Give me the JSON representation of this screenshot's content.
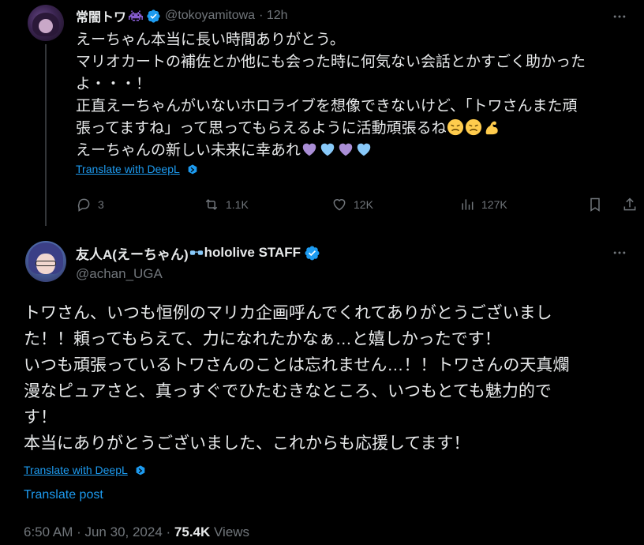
{
  "tweet1": {
    "display_name": "常闇トワ",
    "handle": "@tokoyamitowa",
    "time": "· 12h",
    "lines": [
      "えーちゃん本当に長い時間ありがとう。",
      "マリオカートの補佐とか他にも会った時に何気ない会話とかすごく助かった",
      "よ・・・！",
      "正直えーちゃんがいないホロライブを想像できないけど、「トワさんまた頑",
      "張ってますね」って思ってもらえるように活動頑張るね",
      "えーちゃんの新しい未来に幸あれ"
    ],
    "translate_label": "Translate with DeepL",
    "actions": {
      "replies": "3",
      "reposts": "1.1K",
      "likes": "12K",
      "views": "127K"
    }
  },
  "tweet2": {
    "display_name_prefix": "友人A(えーちゃん)",
    "display_name_suffix": "hololive STAFF",
    "handle": "@achan_UGA",
    "lines": [
      "トワさん、いつも恒例のマリカ企画呼んでくれてありがとうございまし",
      "た！！頼ってもらえて、力になれたかなぁ…と嬉しかったです！",
      "いつも頑張っているトワさんのことは忘れません…！！トワさんの天真爛",
      "漫なピュアさと、真っすぐでひたむきなところ、いつもとても魅力的で",
      "す！",
      "本当にありがとうございました、これからも応援してます！"
    ],
    "translate_label": "Translate with DeepL",
    "translate_post": "Translate post",
    "time": "6:50 AM · Jun 30, 2024 · ",
    "views_count": "75.4K",
    "views_label": " Views"
  },
  "colors": {
    "background": "#000000",
    "text": "#e7e9ea",
    "muted": "#71767b",
    "accent": "#1d9bf0"
  },
  "icons": [
    "more-icon",
    "verified-icon",
    "reply-icon",
    "repost-icon",
    "like-icon",
    "views-icon",
    "bookmark-icon",
    "share-icon",
    "deepl-icon",
    "space-invader-icon"
  ]
}
